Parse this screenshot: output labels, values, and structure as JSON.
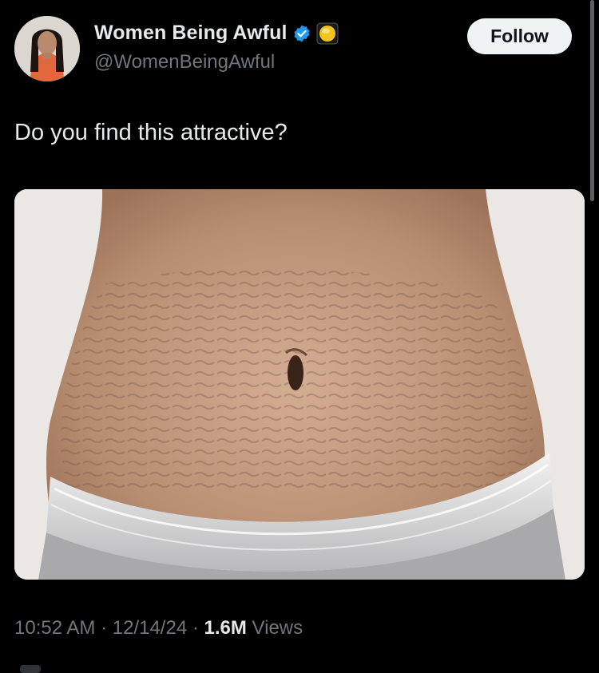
{
  "author": {
    "display_name": "Women Being Awful",
    "handle": "@WomenBeingAwful",
    "avatar_icon": "profile-photo",
    "verified_icon": "verified-badge-icon",
    "affiliation_icon": "gold-affiliate-badge-icon"
  },
  "follow_button": {
    "label": "Follow"
  },
  "tweet": {
    "text": "Do you find this attractive?",
    "media_alt": "photo"
  },
  "meta": {
    "time": "10:52 AM",
    "separator": "·",
    "date": "12/14/24",
    "views_count": "1.6M",
    "views_label": "Views"
  },
  "colors": {
    "background": "#000000",
    "primary_text": "#e7e9ea",
    "secondary_text": "#71767b",
    "verified_blue": "#1d9bf0",
    "follow_bg": "#eff3f4"
  }
}
